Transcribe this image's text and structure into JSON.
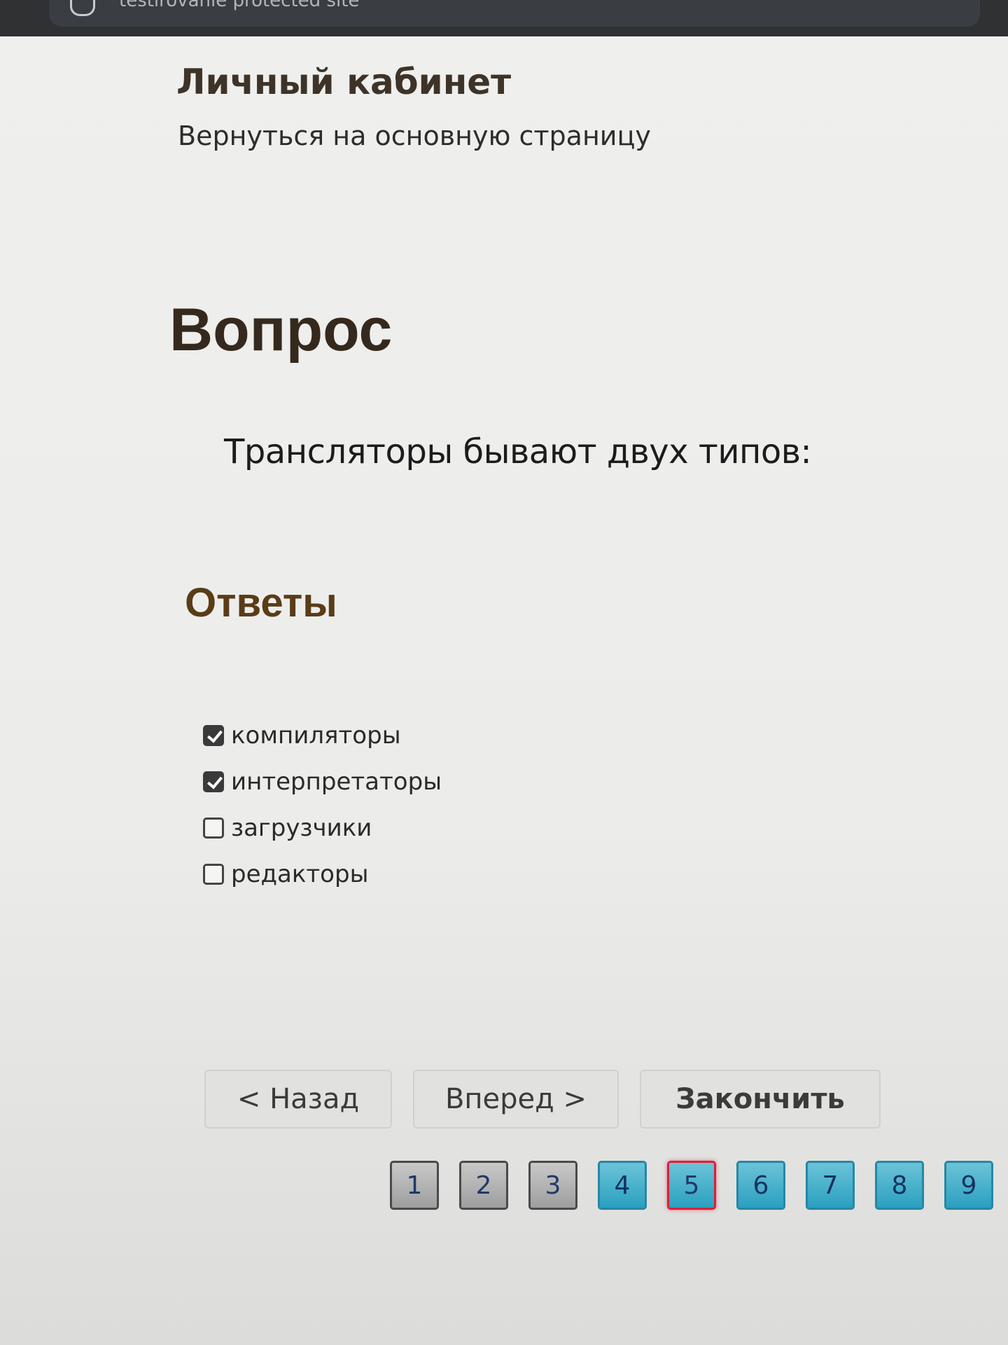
{
  "browser": {
    "address_text": "testirovanie protected site"
  },
  "header": {
    "title": "Личный кабинет",
    "back_link": "Вернуться на основную страницу"
  },
  "question": {
    "heading": "Вопрос",
    "text": "Трансляторы бывают двух типов:"
  },
  "answers": {
    "heading": "Ответы",
    "items": [
      {
        "label": "компиляторы",
        "checked": true
      },
      {
        "label": "интерпретаторы",
        "checked": true
      },
      {
        "label": "загрузчики",
        "checked": false
      },
      {
        "label": "редакторы",
        "checked": false
      }
    ]
  },
  "buttons": {
    "back": "< Назад",
    "next": "Вперед >",
    "finish": "Закончить"
  },
  "pagination": {
    "current": 5,
    "pages": [
      {
        "label": "1",
        "state": "answered"
      },
      {
        "label": "2",
        "state": "answered"
      },
      {
        "label": "3",
        "state": "answered"
      },
      {
        "label": "4",
        "state": "todo"
      },
      {
        "label": "5",
        "state": "current"
      },
      {
        "label": "6",
        "state": "todo"
      },
      {
        "label": "7",
        "state": "todo"
      },
      {
        "label": "8",
        "state": "todo"
      },
      {
        "label": "9",
        "state": "todo"
      }
    ]
  },
  "colors": {
    "answered_page": "#a9a9a9",
    "todo_page": "#2aa0c0",
    "current_page_border": "#d8213a"
  }
}
